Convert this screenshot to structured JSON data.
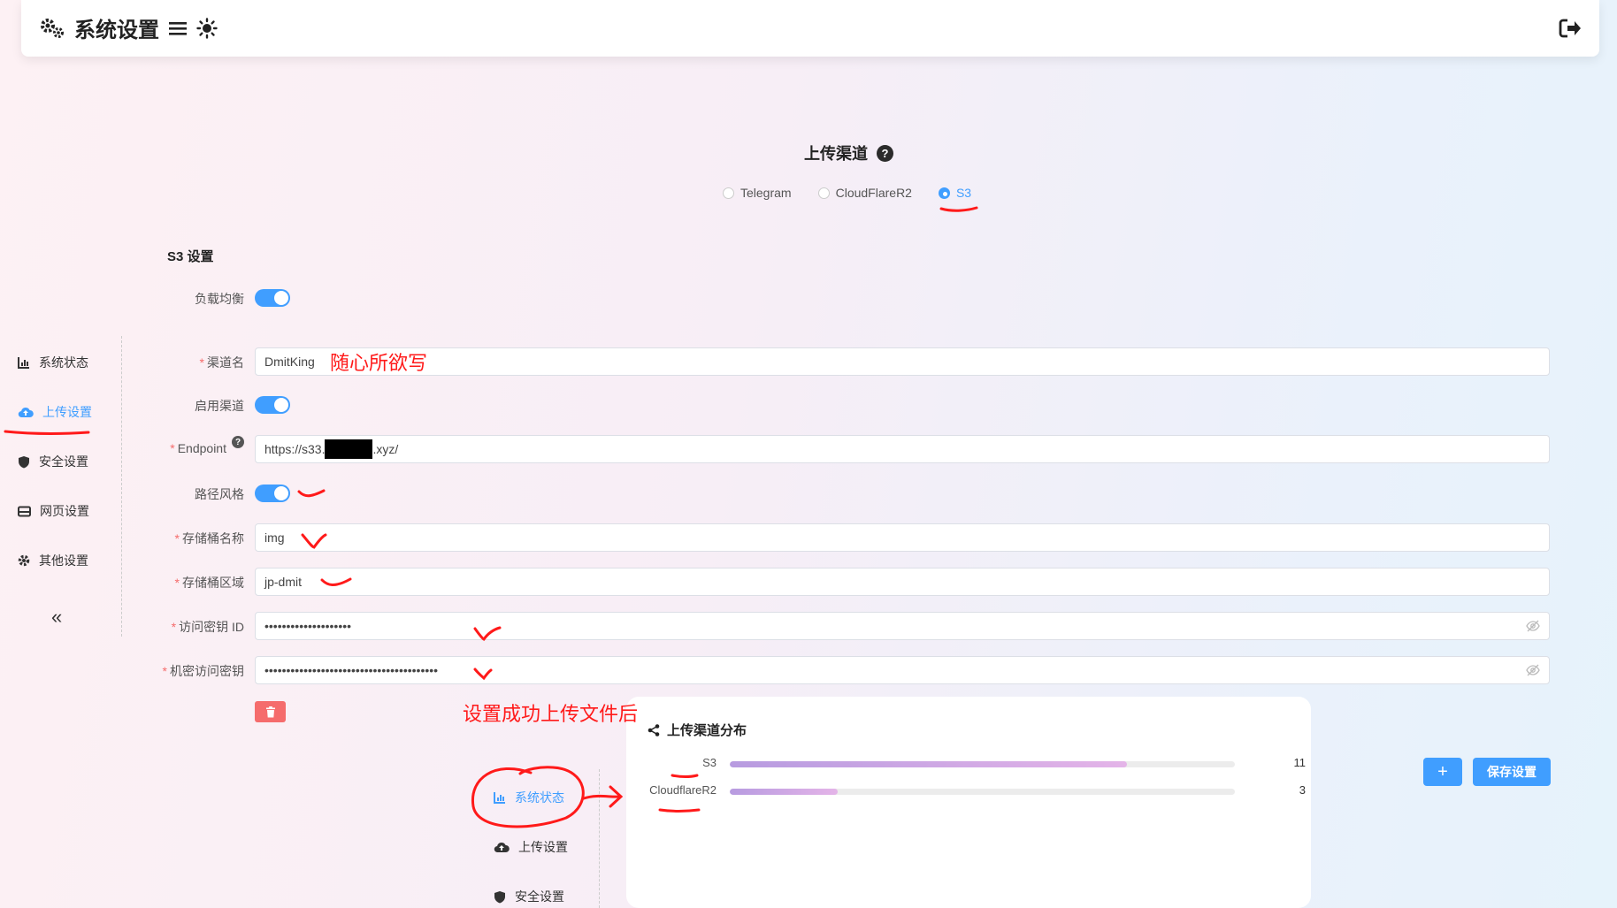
{
  "header": {
    "title": "系统设置"
  },
  "upload": {
    "title": "上传渠道",
    "channels": [
      {
        "label": "Telegram",
        "selected": false
      },
      {
        "label": "CloudFlareR2",
        "selected": false
      },
      {
        "label": "S3",
        "selected": true
      }
    ]
  },
  "s3": {
    "title": "S3 设置",
    "load_balance_label": "负载均衡",
    "channel_name_label": "渠道名",
    "channel_name_value": "DmitKing",
    "enable_label": "启用渠道",
    "endpoint_label": "Endpoint",
    "endpoint_prefix": "https://s33.",
    "endpoint_suffix": ".xyz/",
    "path_style_label": "路径风格",
    "bucket_label": "存储桶名称",
    "bucket_value": "img",
    "region_label": "存储桶区域",
    "region_value": "jp-dmit",
    "access_key_label": "访问密钥 ID",
    "access_key_value": "••••••••••••••••••••",
    "secret_key_label": "机密访问密钥",
    "secret_key_value": "••••••••••••••••••••••••••••••••••••••••"
  },
  "sidebar": {
    "items": [
      {
        "label": "系统状态",
        "icon": "chart-icon",
        "active": false
      },
      {
        "label": "上传设置",
        "icon": "cloud-upload-icon",
        "active": true
      },
      {
        "label": "安全设置",
        "icon": "shield-icon",
        "active": false
      },
      {
        "label": "网页设置",
        "icon": "browser-icon",
        "active": false
      },
      {
        "label": "其他设置",
        "icon": "gear-icon",
        "active": false
      }
    ],
    "collapse": "«"
  },
  "buttons": {
    "add": "+",
    "save": "保存设置"
  },
  "annotations": {
    "channel_note": "随心所欲写",
    "after_note": "设置成功上传文件后"
  },
  "inset": {
    "title": "上传渠道分布",
    "sidebar": [
      {
        "label": "系统状态",
        "active": true
      },
      {
        "label": "上传设置",
        "active": false
      },
      {
        "label": "安全设置",
        "active": false
      }
    ]
  },
  "chart_data": {
    "type": "bar",
    "title": "上传渠道分布",
    "categories": [
      "S3",
      "CloudflareR2"
    ],
    "values": [
      11,
      3
    ],
    "xlim": [
      0,
      14
    ]
  },
  "colors": {
    "accent": "#409eff",
    "danger": "#f56c6c",
    "annotation": "#ff1a1a"
  }
}
